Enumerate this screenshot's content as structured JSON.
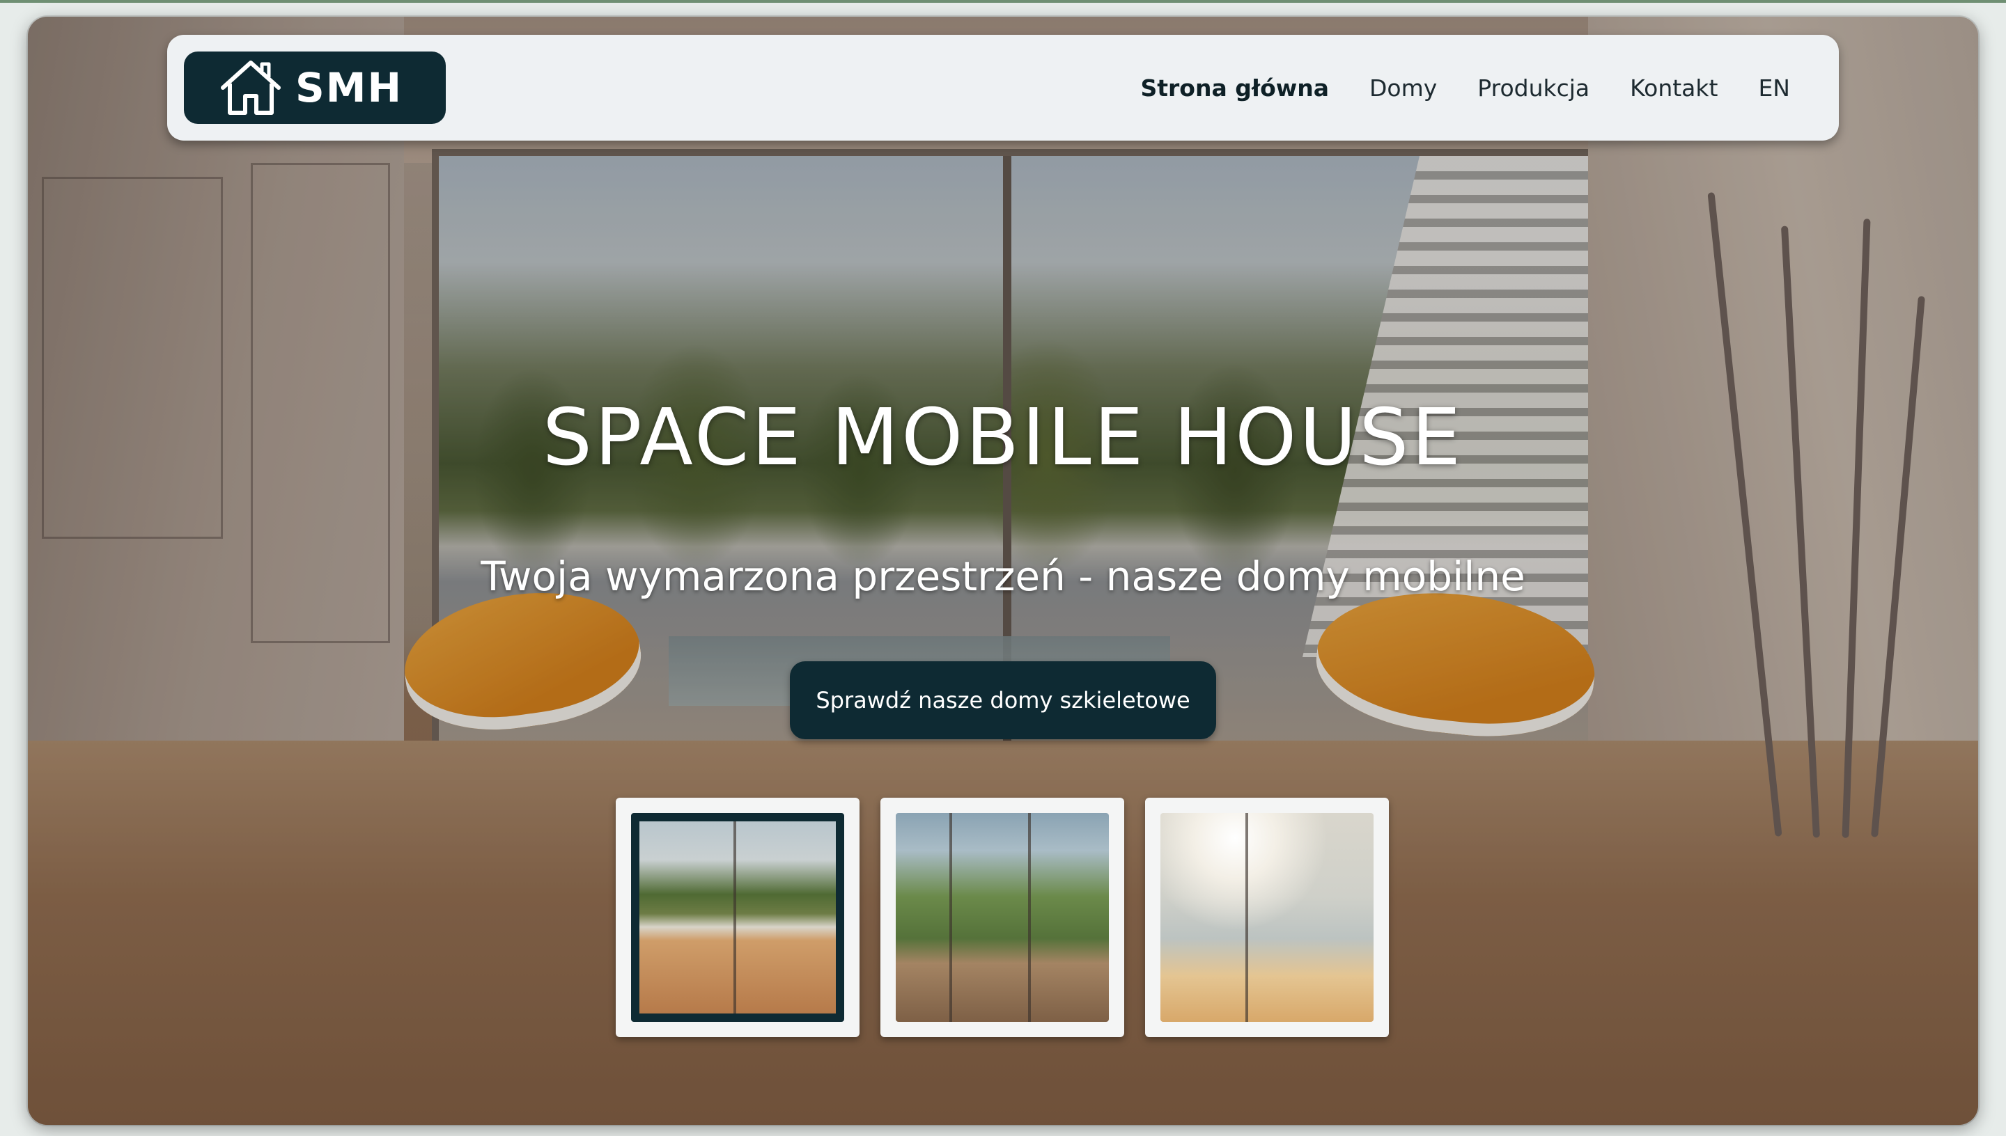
{
  "brand": {
    "logo_text": "SMH",
    "logo_icon": "house-icon",
    "primary_color": "#0e2a33",
    "nav_background": "#eef1f3"
  },
  "nav": {
    "items": [
      {
        "label": "Strona główna",
        "active": true
      },
      {
        "label": "Domy",
        "active": false
      },
      {
        "label": "Produkcja",
        "active": false
      },
      {
        "label": "Kontakt",
        "active": false
      },
      {
        "label": "EN",
        "active": false
      }
    ]
  },
  "hero": {
    "title": "SPACE MOBILE HOUSE",
    "subtitle": "Twoja wymarzona przestrzeń - nasze domy mobilne",
    "cta_label": "Sprawdź nasze domy szkieletowe"
  },
  "gallery": {
    "thumbnails": [
      {
        "selected": true
      },
      {
        "selected": false
      },
      {
        "selected": false
      }
    ]
  }
}
